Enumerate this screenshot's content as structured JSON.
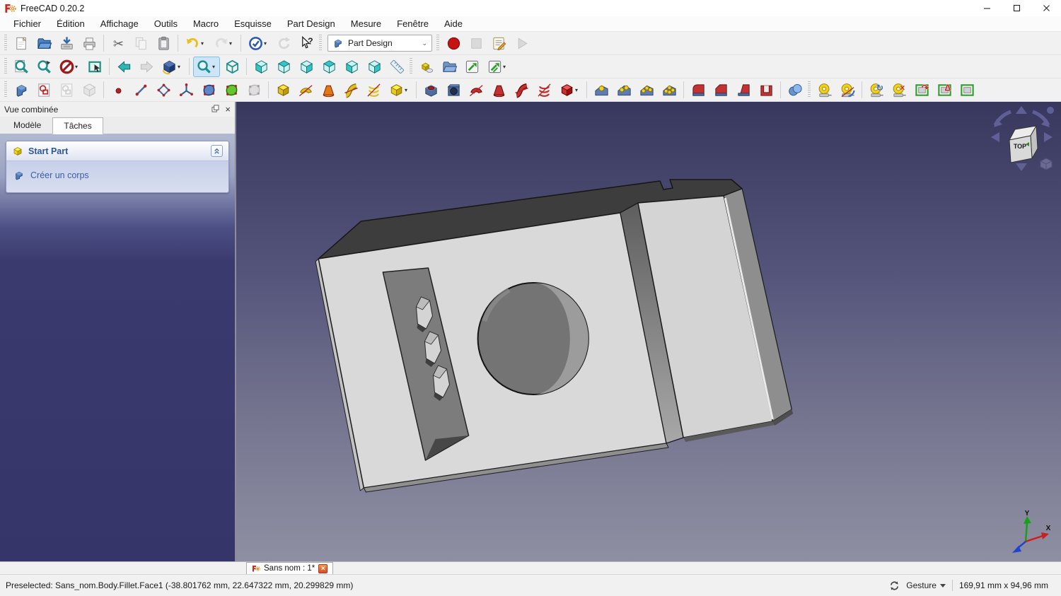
{
  "window": {
    "title": "FreeCAD 0.20.2",
    "controls": [
      {
        "name": "minimize-button"
      },
      {
        "name": "maximize-button"
      },
      {
        "name": "close-button"
      }
    ]
  },
  "menu_bar": [
    "Fichier",
    "Édition",
    "Affichage",
    "Outils",
    "Macro",
    "Esquisse",
    "Part Design",
    "Mesure",
    "Fenêtre",
    "Aide"
  ],
  "workbench_selector": {
    "value": "Part Design"
  },
  "toolbars": {
    "file": [
      {
        "name": "new-document-icon",
        "kind": "page",
        "c": "#f2d24a"
      },
      {
        "name": "open-document-icon",
        "kind": "folder",
        "c": "#4f81bd"
      },
      {
        "name": "save-document-icon",
        "kind": "disk",
        "c": "#3566b0"
      },
      {
        "name": "print-icon",
        "kind": "print",
        "c": "#b8b8b8"
      },
      {
        "kind": "sep"
      },
      {
        "name": "cut-icon",
        "kind": "scissors",
        "c": "#5a5a5a"
      },
      {
        "name": "copy-icon",
        "kind": "copy",
        "c": "#9a9a9a",
        "dis": "true"
      },
      {
        "name": "paste-icon",
        "kind": "clipboard",
        "c": "#b9b9bd"
      },
      {
        "kind": "sep"
      },
      {
        "name": "undo-icon",
        "kind": "curl",
        "c": "#e8c020",
        "dd": "true"
      },
      {
        "name": "redo-icon",
        "kind": "curl",
        "c": "#c4c4c4",
        "dir": "r",
        "dd": "true",
        "dis": "true"
      },
      {
        "kind": "sep"
      },
      {
        "name": "check-circle-icon",
        "kind": "check",
        "c": "#2a58b0",
        "dd": "true"
      },
      {
        "name": "refresh-icon",
        "kind": "refresh",
        "c": "#b8b8b8",
        "dis": "true"
      },
      {
        "name": "whats-this-icon",
        "kind": "helpcur",
        "c": "#2a2a2a"
      }
    ],
    "macro": [
      {
        "name": "macro-record-icon",
        "kind": "record",
        "c": "#c41414"
      },
      {
        "name": "macro-stop-icon",
        "kind": "stop",
        "c": "#bfbfbf",
        "dis": "true"
      },
      {
        "name": "macro-edit-icon",
        "kind": "macro",
        "c": "#e8a030"
      },
      {
        "name": "macro-play-icon",
        "kind": "play",
        "c": "#bdbdbd",
        "dis": "true"
      }
    ],
    "view": [
      {
        "name": "fit-all-icon",
        "kind": "magdoc",
        "c": "#1d8f8f"
      },
      {
        "name": "fit-selection-icon",
        "kind": "magsel",
        "c": "#1d8f8f"
      },
      {
        "name": "draw-style-icon",
        "kind": "noentry",
        "c": "#9e1a1a",
        "dd": "true"
      },
      {
        "name": "box-selection-icon",
        "kind": "selbox",
        "c": "#1d8f7f"
      },
      {
        "kind": "sep"
      },
      {
        "name": "nav-back-icon",
        "kind": "arrow",
        "c": "#35b4b4"
      },
      {
        "name": "nav-forward-icon",
        "kind": "arrow",
        "c": "#c4c4c4",
        "dir": "r",
        "dis": "true"
      },
      {
        "name": "home-view-icon",
        "kind": "isocube",
        "c": "#32528e",
        "dd": "true"
      },
      {
        "kind": "sep"
      },
      {
        "name": "zoom-icon",
        "kind": "mag",
        "c": "#1d8f8f",
        "dd": "true",
        "sel": "true"
      },
      {
        "name": "axonometric-view-icon",
        "kind": "wirecube",
        "c": "#1d8f8f"
      },
      {
        "kind": "sep"
      },
      {
        "name": "view-front-icon",
        "kind": "cube3",
        "f": "l"
      },
      {
        "name": "view-top-icon",
        "kind": "cube3",
        "f": "t"
      },
      {
        "name": "view-right-icon",
        "kind": "cube3",
        "f": "r"
      },
      {
        "name": "view-rear-icon",
        "kind": "cube3",
        "f": "t"
      },
      {
        "name": "view-bottom-icon",
        "kind": "cube3",
        "f": "l"
      },
      {
        "name": "view-left-icon",
        "kind": "cube3",
        "f": "r"
      },
      {
        "name": "measure-distance-icon",
        "kind": "ruler",
        "c": "#5a8aa8"
      }
    ],
    "structure": [
      {
        "name": "create-part-icon",
        "kind": "part",
        "c": "#f0d830"
      },
      {
        "name": "create-group-icon",
        "kind": "folder",
        "c": "#7296c4"
      },
      {
        "name": "make-link-icon",
        "kind": "linkarrow",
        "c": "#28a028"
      },
      {
        "name": "make-link-group-icon",
        "kind": "linkarrow",
        "c": "#28a028",
        "n": "2",
        "dd": "true"
      }
    ],
    "part_design": [
      {
        "name": "create-body-icon",
        "kind": "body",
        "c": "#4d7cb8"
      },
      {
        "name": "create-sketch-icon",
        "kind": "sketch",
        "c": "#cc2222"
      },
      {
        "name": "edit-sketch-icon",
        "kind": "sketch",
        "c": "#aaaaaa",
        "dis": "true"
      },
      {
        "name": "map-sketch-icon",
        "kind": "graybox",
        "c": "#bbbbbb",
        "dis": "true"
      },
      {
        "kind": "sep"
      },
      {
        "name": "datum-point-icon",
        "kind": "dot",
        "c": "#b32222"
      },
      {
        "name": "datum-line-icon",
        "kind": "seg",
        "c": "#4a6a9a"
      },
      {
        "name": "datum-plane-icon",
        "kind": "diamond",
        "c": "#4a6a9a"
      },
      {
        "name": "local-coordinate-system-icon",
        "kind": "axes",
        "c": "#3a5a8a"
      },
      {
        "name": "shape-binder-icon",
        "kind": "blob",
        "c": "#5d87c6"
      },
      {
        "name": "sub-object-shape-binder-icon",
        "kind": "blob",
        "c": "#63c62e"
      },
      {
        "name": "clone-icon",
        "kind": "blob",
        "c": "#c9c9c9",
        "dis": "true"
      },
      {
        "kind": "sep"
      },
      {
        "name": "pad-icon",
        "kind": "box3d",
        "c": "#e0c020"
      },
      {
        "name": "revolution-icon",
        "kind": "swirl",
        "c": "#e0c020"
      },
      {
        "name": "additive-loft-icon",
        "kind": "loft",
        "c": "#e07818"
      },
      {
        "name": "additive-pipe-icon",
        "kind": "pipe",
        "c": "#e0c020"
      },
      {
        "name": "additive-helix-icon",
        "kind": "helix",
        "c": "#e0c020"
      },
      {
        "name": "additive-primitive-icon",
        "kind": "box3d",
        "c": "#e8cc20",
        "dd": "true"
      },
      {
        "kind": "sep"
      },
      {
        "name": "pocket-icon",
        "kind": "pocket",
        "c": "#4d6c9e"
      },
      {
        "name": "hole-icon",
        "kind": "hole",
        "c": "#4d6c9e"
      },
      {
        "name": "groove-icon",
        "kind": "swirl",
        "c": "#c23232"
      },
      {
        "name": "subtractive-loft-icon",
        "kind": "loft",
        "c": "#c23232"
      },
      {
        "name": "subtractive-pipe-icon",
        "kind": "pipe",
        "c": "#c23232"
      },
      {
        "name": "subtractive-helix-icon",
        "kind": "helix",
        "c": "#c23232"
      },
      {
        "name": "subtractive-primitive-icon",
        "kind": "box3d",
        "c": "#c23232",
        "dd": "true"
      },
      {
        "kind": "sep"
      },
      {
        "name": "mirrored-icon",
        "kind": "pattern",
        "n": "1"
      },
      {
        "name": "linear-pattern-icon",
        "kind": "pattern",
        "n": "2"
      },
      {
        "name": "polar-pattern-icon",
        "kind": "pattern",
        "n": "3"
      },
      {
        "name": "multi-transform-icon",
        "kind": "pattern",
        "n": "4"
      },
      {
        "kind": "sep"
      },
      {
        "name": "fillet-icon",
        "kind": "fillet",
        "c": "#c23232"
      },
      {
        "name": "chamfer-icon",
        "kind": "chamfer",
        "c": "#c23232"
      },
      {
        "name": "draft-icon",
        "kind": "draft",
        "c": "#c23232"
      },
      {
        "name": "thickness-icon",
        "kind": "thickness",
        "c": "#c23232"
      },
      {
        "kind": "sep"
      },
      {
        "name": "boolean-operation-icon",
        "kind": "sphere2",
        "c": "#6a94cc"
      }
    ],
    "measure": [
      {
        "name": "measure-linear-icon",
        "kind": "tape"
      },
      {
        "name": "measure-angular-icon",
        "kind": "tapeangle"
      },
      {
        "kind": "sep"
      },
      {
        "name": "measure-refresh-icon",
        "kind": "tape",
        "ov": "↻",
        "ovc": "#3a6ac0"
      },
      {
        "name": "measure-clear-all-icon",
        "kind": "tape",
        "ov": "×",
        "ovc": "#cc2222"
      },
      {
        "name": "toggle-measurements-3d-icon",
        "kind": "panel",
        "ov": "↷",
        "ovc": "#cc2222"
      },
      {
        "name": "toggle-measurements-delta-icon",
        "kind": "panel",
        "ov": "Δ",
        "ovc": "#cc2222"
      },
      {
        "name": "toggle-dimension-overlay-icon",
        "kind": "panel"
      }
    ]
  },
  "combined_view": {
    "title": "Vue combinée",
    "tabs": [
      {
        "label": "Modèle"
      },
      {
        "label": "Tâches"
      }
    ],
    "active_tab": "Tâches",
    "task_panel": {
      "section_title": "Start Part",
      "action_label": "Créer un corps"
    }
  },
  "viewport": {
    "nav_cube_label": "TOP",
    "axis_x_label": "X",
    "axis_y_label": "Y",
    "background_top": "#38385f",
    "background_bottom": "#8f8fa3"
  },
  "mdi_tab": {
    "label": "Sans nom : 1*"
  },
  "status_bar": {
    "message": "Preselected: Sans_nom.Body.Fillet.Face1 (-38.801762 mm, 22.647322 mm, 20.299829 mm)",
    "nav_style_label": "Gesture",
    "dimensions_label": "169,91 mm x 94,96 mm"
  }
}
